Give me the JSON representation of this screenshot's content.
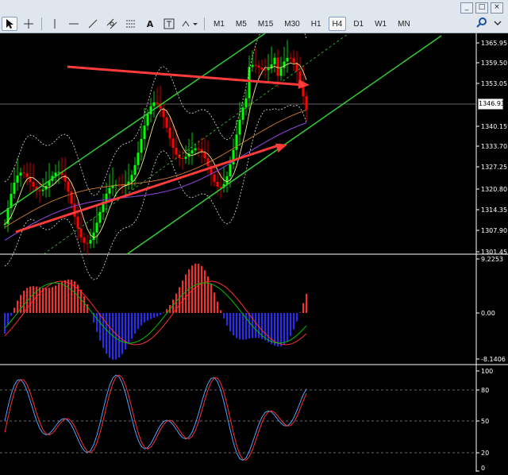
{
  "toolbar": {
    "timeframes": [
      "M1",
      "M5",
      "M15",
      "M30",
      "H1",
      "H4",
      "D1",
      "W1",
      "MN"
    ],
    "active_timeframe": "H4",
    "window_controls": [
      "_",
      "□",
      "×"
    ]
  },
  "main_chart": {
    "price_labels": [
      "1365.95",
      "1359.50",
      "1353.05",
      "1346.93",
      "1340.15",
      "1333.70",
      "1327.25",
      "1320.80",
      "1314.35",
      "1307.90",
      "1301.45"
    ],
    "current_price": "1346.93"
  },
  "macd": {
    "labels": [
      "9.2253",
      "0.00",
      "-8.1406"
    ]
  },
  "stochastic": {
    "labels": [
      "100",
      "80",
      "50",
      "20",
      "0"
    ]
  },
  "colors": {
    "background": "#000000",
    "bull_candle": "#00ff00",
    "bear_candle": "#ff0000",
    "channel": "#33cc33",
    "arrow": "#ff3b3b",
    "bollinger": "#e0e0e0",
    "ma_fast": "#f0e68c",
    "ma_slow": "#7b3fbf",
    "macd_pos": "#ff2a2a",
    "macd_neg": "#2a2aff",
    "signal_green": "#00c000",
    "signal_red": "#ff3030",
    "grid_level": "#888888"
  }
}
